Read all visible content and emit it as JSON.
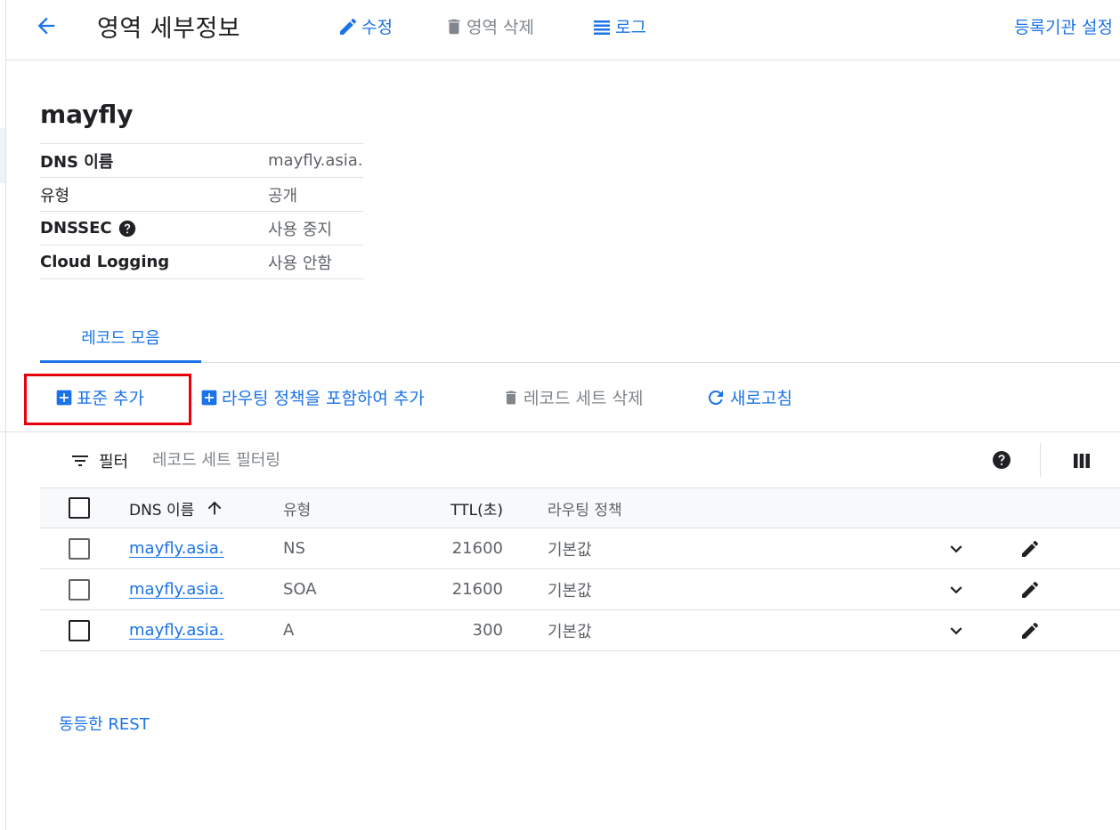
{
  "header": {
    "title": "영역 세부정보",
    "edit_label": "수정",
    "delete_zone_label": "영역 삭제",
    "log_label": "로그",
    "registrar_label": "등록기관 설정"
  },
  "zone": {
    "name": "mayfly",
    "details": [
      {
        "label": "DNS 이름",
        "value": "mayfly.asia."
      },
      {
        "label": "유형",
        "value": "공개"
      },
      {
        "label": "DNSSEC",
        "value": "사용 중지"
      },
      {
        "label": "Cloud Logging",
        "value": "사용 안함"
      }
    ]
  },
  "tabs": [
    {
      "label": "레코드 모음"
    }
  ],
  "actions": {
    "add_standard": "표준 추가",
    "add_with_routing": "라우팅 정책을 포함하여 추가",
    "delete_record_set": "레코드 세트 삭제",
    "refresh": "새로고침"
  },
  "filter": {
    "label": "필터",
    "placeholder": "레코드 세트 필터링"
  },
  "table": {
    "columns": {
      "name": "DNS 이름",
      "type": "유형",
      "ttl": "TTL(초)",
      "policy": "라우팅 정책"
    },
    "rows": [
      {
        "name": "mayfly.asia.",
        "type": "NS",
        "ttl": "21600",
        "policy": "기본값"
      },
      {
        "name": "mayfly.asia.",
        "type": "SOA",
        "ttl": "21600",
        "policy": "기본값"
      },
      {
        "name": "mayfly.asia.",
        "type": "A",
        "ttl": "300",
        "policy": "기본값"
      }
    ]
  },
  "footer": {
    "rest_link": "동등한 REST"
  },
  "colors": {
    "accent": "#1a73e8",
    "highlight": "#e8000b",
    "muted": "#80868b"
  },
  "icons": {
    "back": "arrow-back-icon",
    "edit": "pencil-icon",
    "delete": "trash-icon",
    "log": "list-icon",
    "add": "plus-box-icon",
    "refresh": "refresh-icon",
    "filter": "filter-icon",
    "help": "help-circle-icon",
    "columns": "column-display-icon",
    "sort": "arrow-up-icon",
    "expand": "chevron-down-icon"
  }
}
